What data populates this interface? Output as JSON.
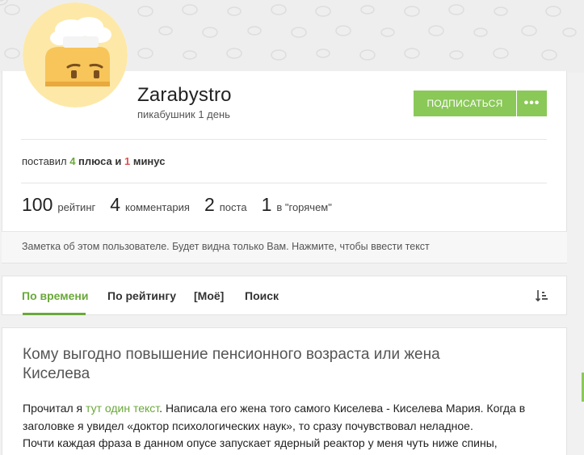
{
  "profile": {
    "username": "Zarabystro",
    "status": "пикабушник 1 день",
    "subscribe_label": "Подписаться",
    "more_label": "•••"
  },
  "votes": {
    "prefix": "поставил",
    "plus_count": "4",
    "plus_word": "плюса",
    "conj": "и",
    "minus_count": "1",
    "minus_word": "минус"
  },
  "stats": [
    {
      "num": "100",
      "label": "рейтинг"
    },
    {
      "num": "4",
      "label": "комментария"
    },
    {
      "num": "2",
      "label": "поста"
    },
    {
      "num": "1",
      "label": "в \"горячем\""
    }
  ],
  "note": {
    "placeholder": "Заметка об этом пользователе. Будет видна только Вам. Нажмите, чтобы ввести текст"
  },
  "tabs": [
    {
      "label": "По времени",
      "active": true
    },
    {
      "label": "По рейтингу",
      "active": false
    },
    {
      "label": "[Моё]",
      "active": false
    },
    {
      "label": "Поиск",
      "active": false
    }
  ],
  "post": {
    "title": "Кому выгодно повышение пенсионного возраста или жена Киселева",
    "line1_before": "Прочитал я ",
    "line1_link": "тут один текст",
    "line1_after": ". Написала его жена того самого Киселева - Киселева Мария. Когда в",
    "line2": "заголовке я увидел «доктор психологических наук», то сразу почувствовал неладное.",
    "line3": "Почти каждая фраза в данном опусе запускает ядерный реактор у меня чуть ниже спины,"
  },
  "colors": {
    "accent": "#8ac858",
    "link": "#6aa83a",
    "minus": "#e05050"
  }
}
